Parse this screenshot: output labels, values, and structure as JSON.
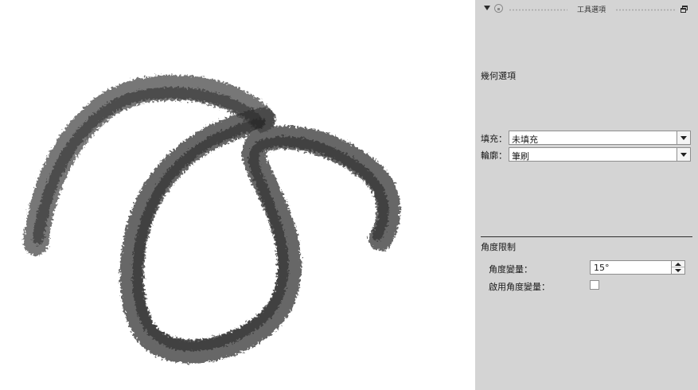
{
  "panel": {
    "title": "工具選項",
    "geometry_heading": "幾何選項",
    "fill_label": "填充：",
    "fill_value": "未填充",
    "outline_label": "輪廓：",
    "outline_value": "筆刷",
    "angle_heading": "角度限制",
    "angle_delta_label": "角度變量：",
    "angle_delta_value": "15°",
    "enable_angle_label": "啟用角度變量：",
    "enable_angle_checked": false
  },
  "canvas": {
    "stroke_color": "#3a3a3a",
    "background": "#ffffff"
  },
  "colors": {
    "panel_bg": "#d4d4d4",
    "field_bg": "#ffffff"
  }
}
